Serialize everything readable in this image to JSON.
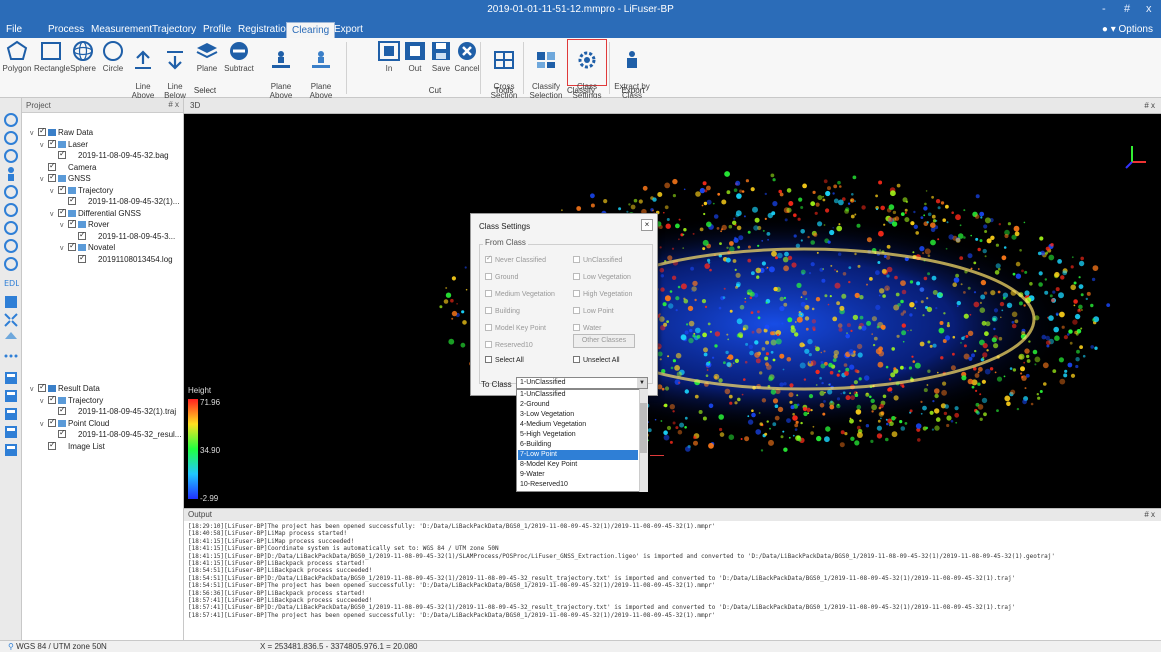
{
  "window": {
    "title": "2019-01-01-11-51-12.mmpro - LiFuser-BP",
    "controls": [
      "-",
      "#",
      "x"
    ],
    "options_label": "Options"
  },
  "menu": [
    "File",
    "Process",
    "Measurement",
    "Trajectory",
    "Profile",
    "Registration",
    "Clearing",
    "Export"
  ],
  "ribbon": {
    "select": {
      "group": "Select",
      "buttons": [
        "Polygon",
        "Rectangle",
        "Sphere",
        "Circle",
        "Line\nAbove",
        "Line\nBelow",
        "Plane",
        "Subtract",
        "Plane\nAbove",
        "Plane Above\nSettings"
      ]
    },
    "cut": {
      "group": "Cut",
      "buttons": [
        "In",
        "Out",
        "Save",
        "Cancel"
      ]
    },
    "tools": {
      "group": "Tools",
      "buttons": [
        "Cross\nSection"
      ]
    },
    "classify": {
      "group": "Classify",
      "buttons": [
        "Classify\nSelection",
        "Class\nSettings"
      ]
    },
    "export": {
      "group": "Export",
      "buttons": [
        "Extract by\nClass"
      ]
    }
  },
  "project_panel": {
    "title": "Project",
    "pin": "# x",
    "tree": [
      {
        "label": "Raw Data",
        "level": 0,
        "exp": "v"
      },
      {
        "label": "Laser",
        "level": 1,
        "exp": "v"
      },
      {
        "label": "2019-11-08-09-45-32.bag",
        "level": 2,
        "exp": ""
      },
      {
        "label": "Camera",
        "level": 1,
        "exp": ""
      },
      {
        "label": "GNSS",
        "level": 1,
        "exp": "v"
      },
      {
        "label": "Trajectory",
        "level": 2,
        "exp": "v"
      },
      {
        "label": "2019-11-08-09-45-32(1)...",
        "level": 3,
        "exp": ""
      },
      {
        "label": "Differential GNSS",
        "level": 2,
        "exp": "v"
      },
      {
        "label": "Rover",
        "level": 3,
        "exp": "v"
      },
      {
        "label": "2019-11-08-09-45-3...",
        "level": 4,
        "exp": ""
      },
      {
        "label": "Novatel",
        "level": 3,
        "exp": "v"
      },
      {
        "label": "20191108013454.log",
        "level": 4,
        "exp": ""
      }
    ],
    "result_tree": [
      {
        "label": "Result Data",
        "level": 0,
        "exp": "v"
      },
      {
        "label": "Trajectory",
        "level": 1,
        "exp": "v"
      },
      {
        "label": "2019-11-08-09-45-32(1).traj",
        "level": 2,
        "exp": ""
      },
      {
        "label": "Point Cloud",
        "level": 1,
        "exp": "v"
      },
      {
        "label": "2019-11-08-09-45-32_resul...",
        "level": 2,
        "exp": ""
      },
      {
        "label": "Image List",
        "level": 1,
        "exp": ""
      }
    ]
  },
  "viewport": {
    "tab": "3D",
    "pin": "# x",
    "legend_title": "Height",
    "legend_max": "71.96",
    "legend_mid": "34.90",
    "legend_min": "-2.99"
  },
  "class_settings": {
    "title": "Class Settings",
    "from_class_label": "From Class",
    "options": [
      {
        "label": "Never Classified",
        "checked": true,
        "enabled": false
      },
      {
        "label": "UnClassified",
        "checked": false,
        "enabled": false
      },
      {
        "label": "Ground",
        "checked": false,
        "enabled": false
      },
      {
        "label": "Low Vegetation",
        "checked": false,
        "enabled": false
      },
      {
        "label": "Medium Vegetation",
        "checked": false,
        "enabled": false
      },
      {
        "label": "High Vegetation",
        "checked": false,
        "enabled": false
      },
      {
        "label": "Building",
        "checked": false,
        "enabled": false
      },
      {
        "label": "Low Point",
        "checked": false,
        "enabled": false
      },
      {
        "label": "Model Key Point",
        "checked": false,
        "enabled": false
      },
      {
        "label": "Water",
        "checked": false,
        "enabled": false
      },
      {
        "label": "Reserved10",
        "checked": false,
        "enabled": false
      }
    ],
    "other_classes": "Other Classes",
    "select_all": "Select All",
    "unselect_all": "Unselect All",
    "to_class_label": "To Class",
    "to_class_value": "1-UnClassified",
    "dropdown_items": [
      "1-UnClassified",
      "2-Ground",
      "3-Low Vegetation",
      "4-Medium Vegetation",
      "5-High Vegetation",
      "6-Building",
      "7-Low Point",
      "8-Model Key Point",
      "9-Water",
      "10-Reserved10"
    ],
    "selected_item": "7-Low Point"
  },
  "output": {
    "title": "Output",
    "pin": "# x",
    "lines": [
      "[18:29:10][LiFuser-BP]The project has been opened successfully: 'D:/Data/LiBackPackData/BGS0_1/2019-11-08-09-45-32(1)/2019-11-08-09-45-32(1).mmpr'",
      "[18:40:58][LiFuser-BP]LiMap process started!",
      "[18:41:15][LiFuser-BP]LiMap process succeeded!",
      "[18:41:15][LiFuser-BP]Coordinate system is automatically set to: WGS 84 / UTM zone 50N",
      "[18:41:15][LiFuser-BP]D:/Data/LiBackPackData/BGS0_1/2019-11-08-09-45-32(1)/SLAMProcess/POSProc/LiFuser_GNSS_Extraction.ligeo' is imported and converted to 'D:/Data/LiBackPackData/BGS0_1/2019-11-08-09-45-32(1)/2019-11-08-09-45-32(1).geotraj'",
      "[18:41:15][LiFuser-BP]LiBackpack process started!",
      "[18:54:51][LiFuser-BP]LiBackpack process succeeded!",
      "[18:54:51][LiFuser-BP]D:/Data/LiBackPackData/BGS0_1/2019-11-08-09-45-32(1)/2019-11-08-09-45-32_result_trajectory.txt' is imported and converted to 'D:/Data/LiBackPackData/BGS0_1/2019-11-08-09-45-32(1)/2019-11-08-09-45-32(1).traj'",
      "[18:54:51][LiFuser-BP]The project has been opened successfully: 'D:/Data/LiBackPackData/BGS0_1/2019-11-08-09-45-32(1)/2019-11-08-09-45-32(1).mmpr'",
      "[18:56:36][LiFuser-BP]LiBackpack process started!",
      "[18:57:41][LiFuser-BP]LiBackpack process succeeded!",
      "[18:57:41][LiFuser-BP]D:/Data/LiBackPackData/BGS0_1/2019-11-08-09-45-32(1)/2019-11-08-09-45-32_result_trajectory.txt' is imported and converted to 'D:/Data/LiBackPackData/BGS0_1/2019-11-08-09-45-32(1)/2019-11-08-09-45-32(1).traj'",
      "[18:57:41][LiFuser-BP]The project has been opened successfully: 'D:/Data/LiBackPackData/BGS0_1/2019-11-08-09-45-32(1)/2019-11-08-09-45-32(1).mmpr'"
    ]
  },
  "status": {
    "crs": "WGS 84 / UTM zone 50N",
    "coords": "X = 253481.836.5 - 3374805.976.1 = 20.080"
  },
  "colors": {
    "accent": "#2b6cb8",
    "highlight": "#e03a3a",
    "selection": "#2f7fd6"
  }
}
